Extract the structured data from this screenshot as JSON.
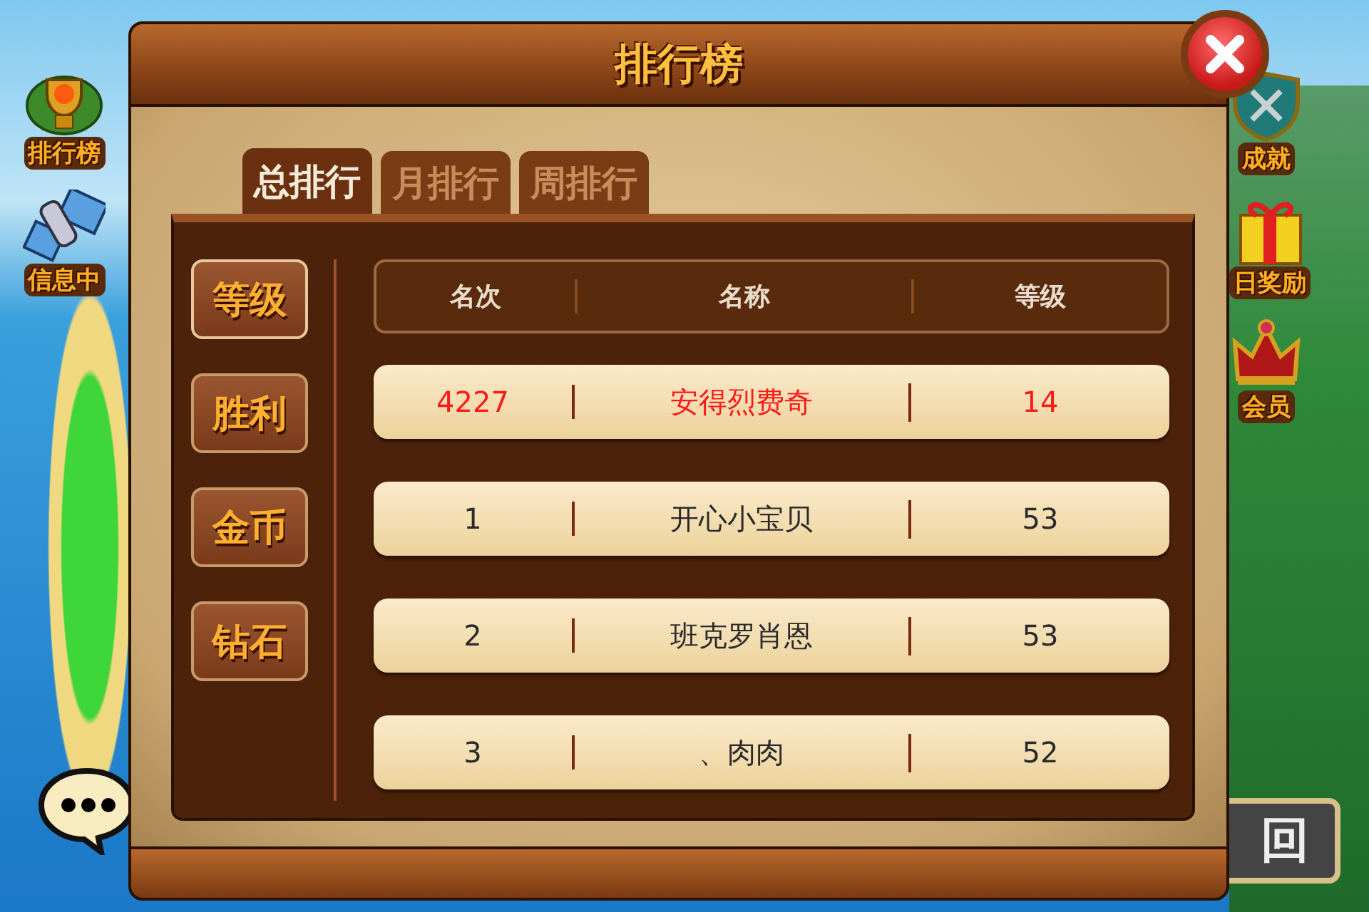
{
  "background": {
    "left_menu": [
      {
        "label": "排行榜",
        "kind": "trophy"
      },
      {
        "label": "信息中",
        "kind": "satellite"
      }
    ],
    "right_menu": [
      {
        "label": "成就",
        "kind": "shield"
      },
      {
        "label": "日奖励",
        "kind": "gift"
      },
      {
        "label": "会员",
        "kind": "crown"
      }
    ],
    "back_button": {
      "label": "回"
    }
  },
  "dialog": {
    "title": "排行榜",
    "tabs": [
      {
        "label": "总排行",
        "selected": true
      },
      {
        "label": "月排行",
        "selected": false
      },
      {
        "label": "周排行",
        "selected": false
      }
    ],
    "categories": [
      {
        "label": "等级",
        "selected": true
      },
      {
        "label": "胜利",
        "selected": false
      },
      {
        "label": "金币",
        "selected": false
      },
      {
        "label": "钻石",
        "selected": false
      }
    ],
    "table": {
      "columns": [
        "名次",
        "名称",
        "等级"
      ],
      "rows": [
        {
          "rank": "4227",
          "name": "安得烈费奇",
          "level": "14",
          "is_self": true
        },
        {
          "rank": "1",
          "name": "开心小宝贝",
          "level": "53",
          "is_self": false
        },
        {
          "rank": "2",
          "name": "班克罗肖恩",
          "level": "53",
          "is_self": false
        },
        {
          "rank": "3",
          "name": "、肉肉",
          "level": "52",
          "is_self": false
        }
      ]
    }
  }
}
